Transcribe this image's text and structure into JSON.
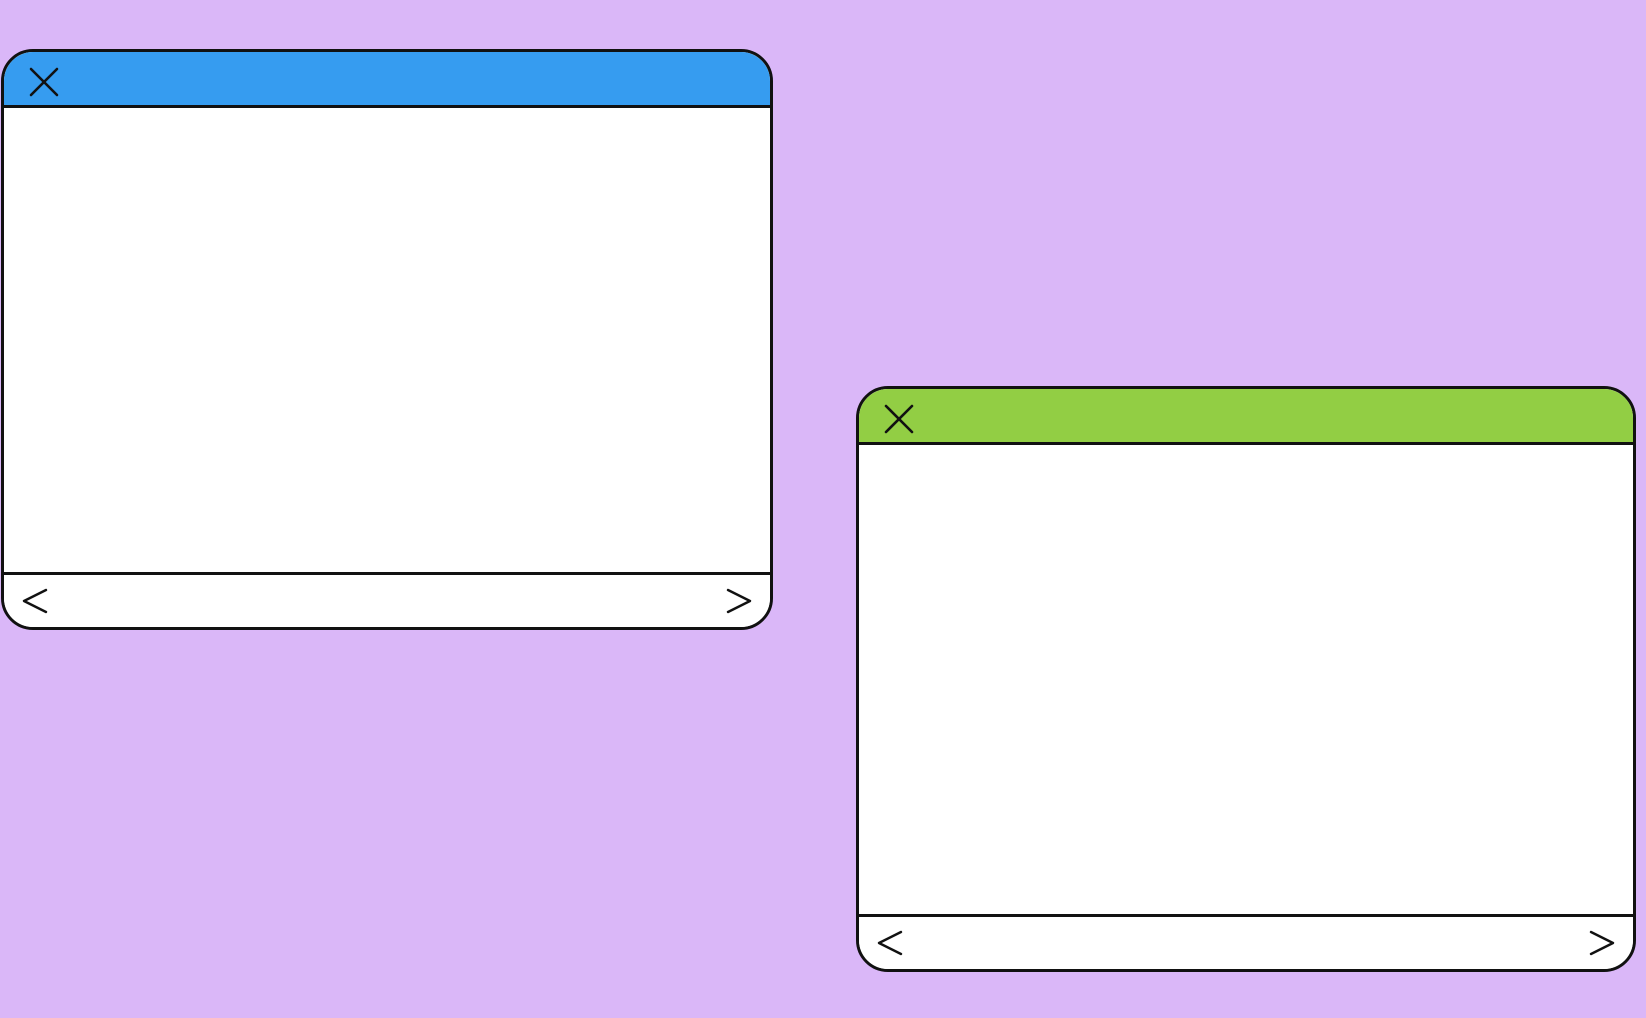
{
  "desktop": {
    "background_color": "#dab7f8"
  },
  "windows": [
    {
      "titlebar_color": "#369cf0",
      "close_icon": "close-icon",
      "prev_icon": "chevron-left-icon",
      "next_icon": "chevron-right-icon"
    },
    {
      "titlebar_color": "#92ce44",
      "close_icon": "close-icon",
      "prev_icon": "chevron-left-icon",
      "next_icon": "chevron-right-icon"
    }
  ]
}
